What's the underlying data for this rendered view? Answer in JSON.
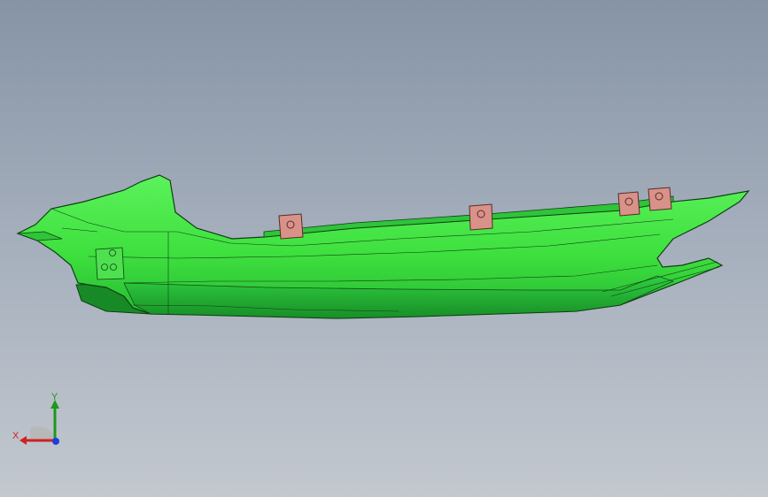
{
  "viewport": {
    "background_top": "#8694a6",
    "background_bottom": "#c3c8cf"
  },
  "model": {
    "name": "side-cover-part",
    "body_color": "#3ee03e",
    "shadow_color": "#1f9a2a",
    "edge_color": "#0f3f12",
    "bracket_color": "#d8928a",
    "bracket_count": 4
  },
  "triad": {
    "x_label": "X",
    "y_label": "Y",
    "x_color": "#d02020",
    "y_color": "#1a9a1a",
    "z_color": "#1f3fd8"
  }
}
